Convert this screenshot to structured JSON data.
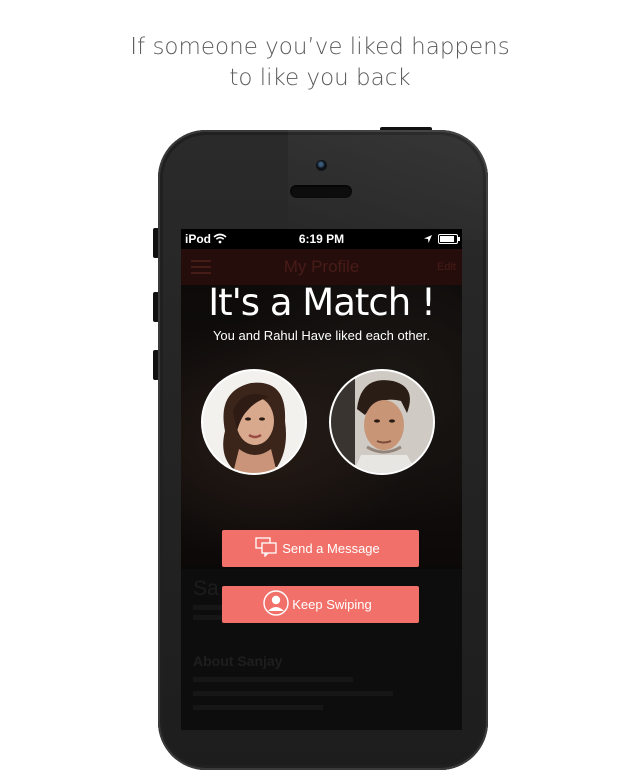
{
  "headline": {
    "line1": "If someone you’ve liked happens",
    "line2": "to like you back"
  },
  "status_bar": {
    "carrier": "iPod",
    "time": "6:19 PM",
    "icons": [
      "wifi-icon",
      "location-arrow-icon",
      "battery-icon"
    ]
  },
  "background_profile": {
    "nav_title": "My Profile",
    "edit_label": "Edit",
    "name": "Sa",
    "about_heading": "About Sanjay"
  },
  "match": {
    "title": "It's a Match !",
    "subtitle": "You and Rahul Have liked each other."
  },
  "buttons": {
    "send_message": "Send a Message",
    "keep_swiping": "Keep Swiping"
  },
  "colors": {
    "accent": "#f1716a",
    "headline": "#5a5a5a",
    "phone": "#1e1e1e"
  }
}
